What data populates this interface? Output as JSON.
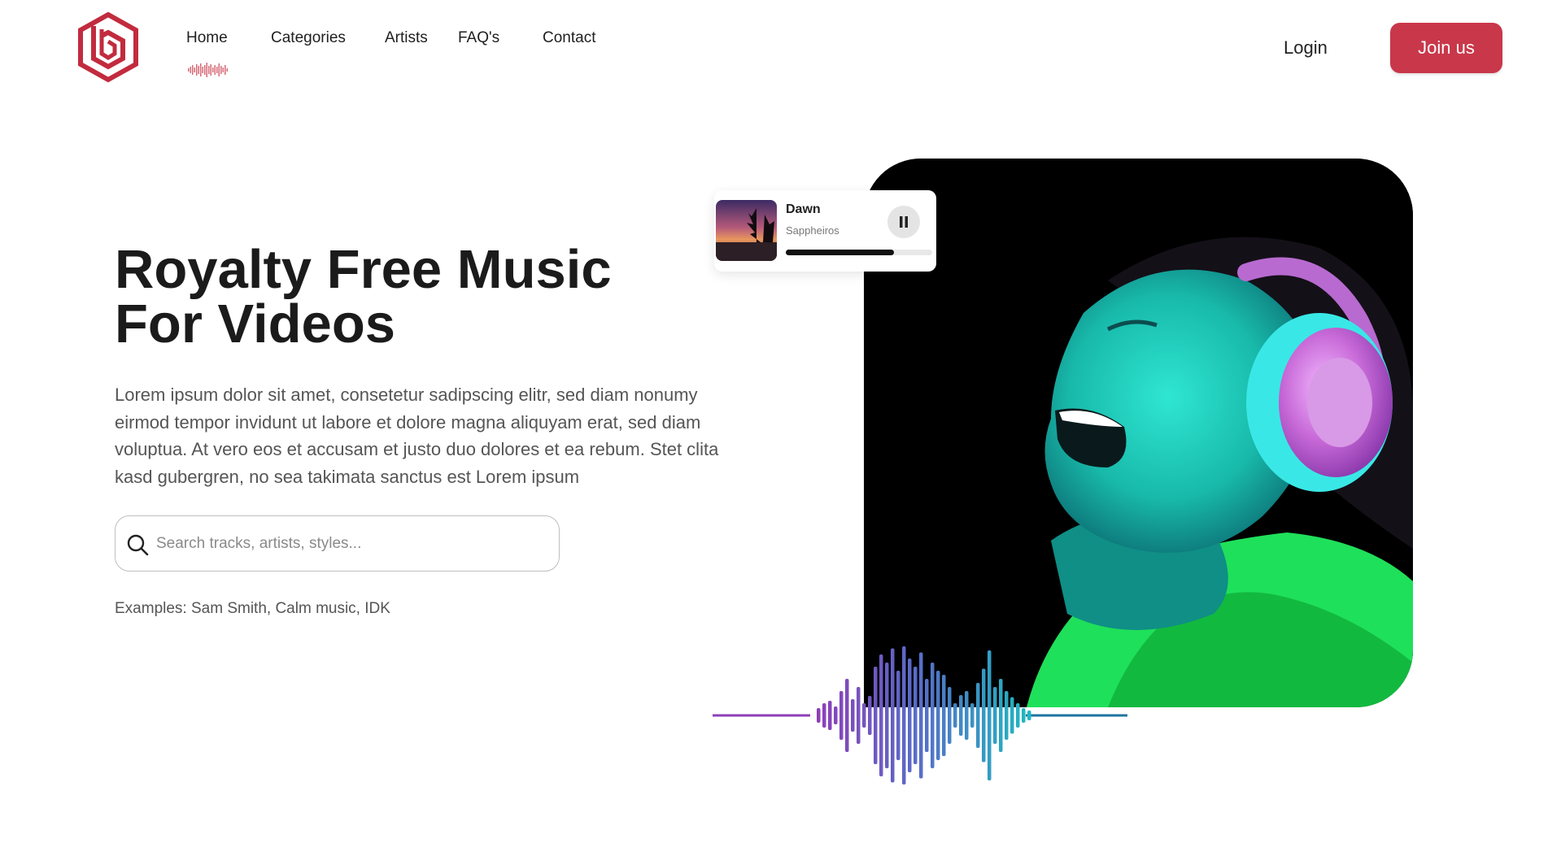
{
  "header": {
    "logo_name": "brand-logo",
    "nav": [
      {
        "label": "Home",
        "active": true
      },
      {
        "label": "Categories"
      },
      {
        "label": "Artists"
      },
      {
        "label": "FAQ's"
      },
      {
        "label": "Contact"
      }
    ],
    "login_label": "Login",
    "join_label": "Join us"
  },
  "hero": {
    "title_line1": "Royalty Free Music",
    "title_line2": "For Videos",
    "description": "Lorem ipsum dolor sit amet, consetetur sadipscing elitr, sed diam nonumy eirmod tempor invidunt ut labore et dolore magna aliquyam erat, sed diam voluptua. At vero eos et accusam et justo duo dolores et ea rebum. Stet clita kasd gubergren, no sea takimata sanctus est Lorem ipsum",
    "search_placeholder": "Search tracks, artists, styles...",
    "search_value": "",
    "examples": "Examples: Sam Smith, Calm music, IDK"
  },
  "player": {
    "track_title": "Dawn",
    "artist": "Sappheiros",
    "progress": 0.74,
    "state": "playing"
  },
  "colors": {
    "accent": "#c9374a",
    "wave_start": "#8e3fb8",
    "wave_mid": "#5470c8",
    "wave_end": "#1fb8c0"
  }
}
